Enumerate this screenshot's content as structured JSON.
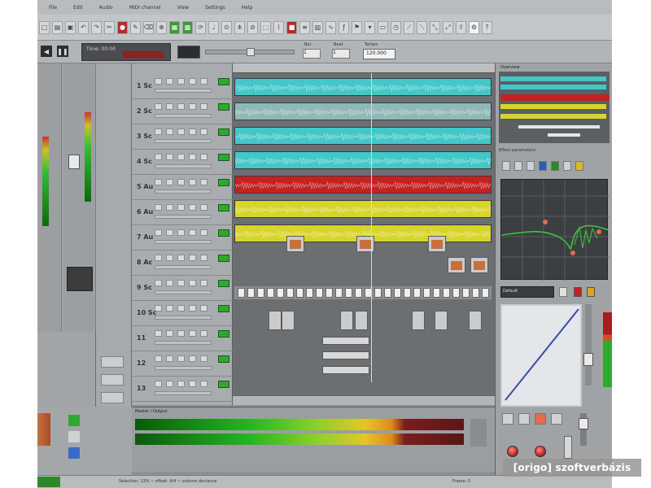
{
  "menu": [
    "File",
    "Edit",
    "Audio",
    "MIDI channel",
    "View",
    "Settings",
    "Help"
  ],
  "transport": {
    "lcd_label": "Time: 00:00",
    "beat_label": "Beat",
    "bar_label": "Bar",
    "tempo_label": "Tempo",
    "tempo_value": "120.000",
    "position_value": "1",
    "beat_value": "1"
  },
  "tracks": [
    {
      "num": "1 Sc",
      "color": "#43c7c9"
    },
    {
      "num": "2 Sc",
      "color": "#8fb8b8"
    },
    {
      "num": "3 Sc",
      "color": "#43c7c9"
    },
    {
      "num": "4 Sc",
      "color": "#43c7c9"
    },
    {
      "num": "5 Au",
      "color": "#c42222"
    },
    {
      "num": "6 Au",
      "color": "#d7d42a"
    },
    {
      "num": "7 Au",
      "color": "#d7d42a"
    },
    {
      "num": "8 Ac",
      "color": "#9ea1a5"
    },
    {
      "num": "9 Sc",
      "color": "#9ea1a5"
    },
    {
      "num": "10 Sc",
      "color": "#9ea1a5"
    },
    {
      "num": "11",
      "color": "#9ea1a5"
    },
    {
      "num": "12",
      "color": "#9ea1a5"
    },
    {
      "num": "13",
      "color": "#9ea1a5"
    }
  ],
  "right_panel": {
    "overview_title": "Overview",
    "fx_title": "Effect parameters",
    "preset": "Default"
  },
  "bottom": {
    "meter_title": "Master / Output",
    "status_text": "Selection: 13% ~ offset: 4/4 ~ volume deviance",
    "status_right": "Frame: 0"
  },
  "watermark": "[origo] szoftverbázis",
  "colors": {
    "cyan_clip": "#43c7c9",
    "red_clip": "#c42222",
    "yellow_clip": "#d7d42a",
    "accent_green": "#2fa82f"
  }
}
